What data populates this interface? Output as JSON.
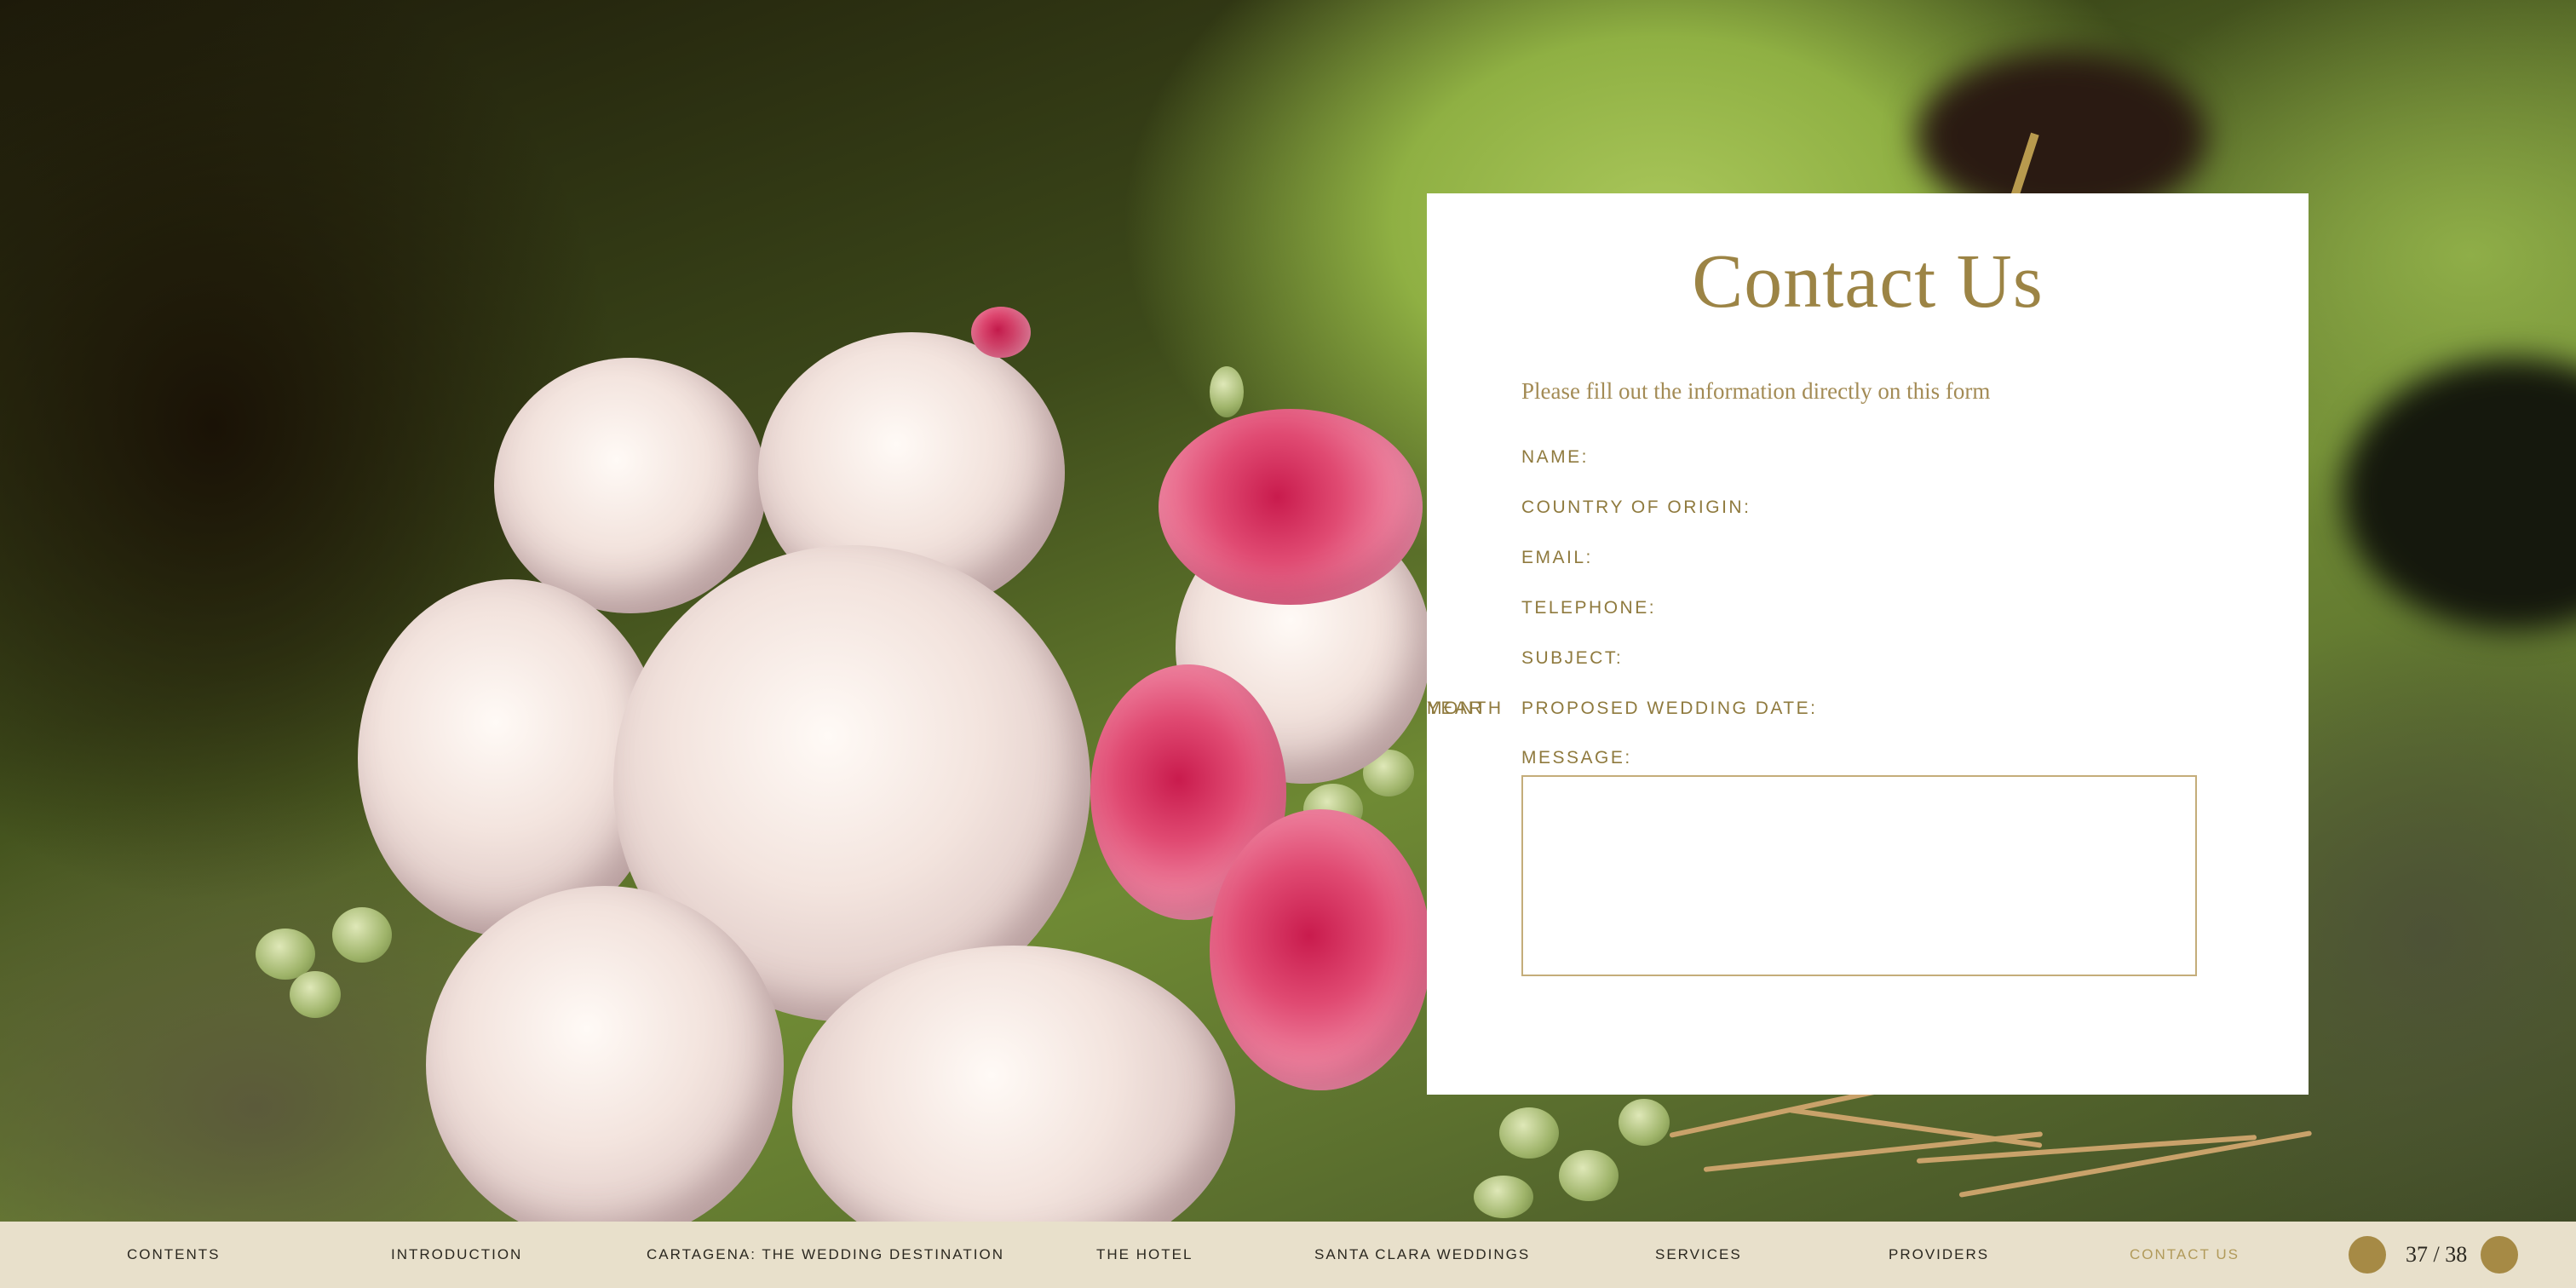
{
  "contact": {
    "title": "Contact Us",
    "intro": "Please fill out the information directly on this form",
    "fields": {
      "name": "NAME:",
      "country": "COUNTRY OF ORIGIN:",
      "email": "EMAIL:",
      "telephone": "TELEPHONE:",
      "subject": "SUBJECT:",
      "wedding_date": "PROPOSED WEDDING DATE:",
      "month": "MONTH",
      "year": "YEAR",
      "message": "MESSAGE:"
    },
    "message_value": ""
  },
  "nav": {
    "items": [
      {
        "label": "CONTENTS"
      },
      {
        "label": "INTRODUCTION"
      },
      {
        "label": "CARTAGENA: THE WEDDING DESTINATION"
      },
      {
        "label": "THE HOTEL"
      },
      {
        "label": "SANTA CLARA WEDDINGS"
      },
      {
        "label": "SERVICES"
      },
      {
        "label": "PROVIDERS"
      },
      {
        "label": "CONTACT US"
      }
    ],
    "active_label": "CONTACT US",
    "page_indicator": "37 / 38"
  },
  "colors": {
    "accent_gold": "#9c8445",
    "nav_background": "#e8e0cb",
    "pager_button": "#a68a45"
  },
  "icons": {
    "prev": "previous-page-circle-icon",
    "next": "next-page-circle-icon"
  }
}
